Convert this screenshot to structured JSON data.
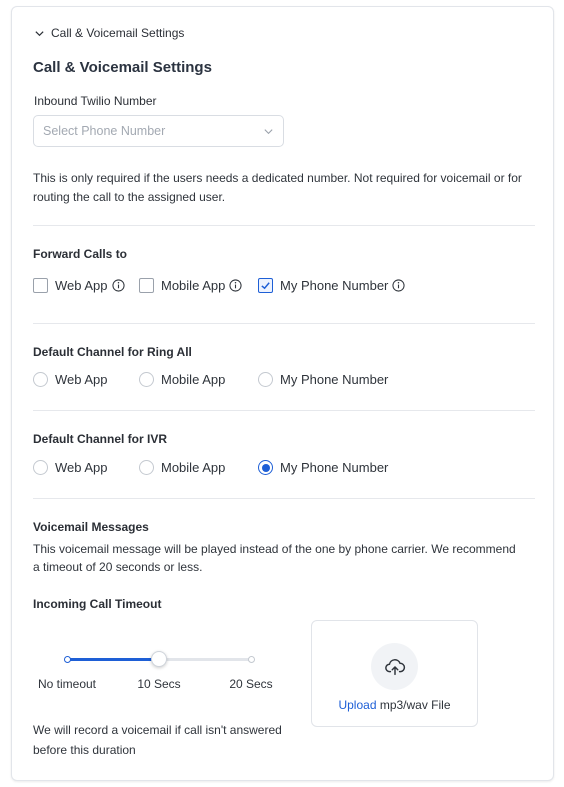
{
  "collapse": {
    "label": "Call & Voicemail Settings"
  },
  "title": "Call & Voicemail Settings",
  "inbound": {
    "label": "Inbound Twilio Number",
    "placeholder": "Select Phone Number",
    "help": "This is only required if the users needs a dedicated number. Not required for voicemail or for routing the call to the assigned user."
  },
  "forward": {
    "label": "Forward Calls to",
    "options": [
      {
        "label": "Web App",
        "checked": false
      },
      {
        "label": "Mobile App",
        "checked": false
      },
      {
        "label": "My Phone Number",
        "checked": true
      }
    ]
  },
  "ring_all": {
    "label": "Default Channel for Ring All",
    "options": [
      "Web App",
      "Mobile App",
      "My Phone Number"
    ],
    "selected": null
  },
  "ivr": {
    "label": "Default Channel for IVR",
    "options": [
      "Web App",
      "Mobile App",
      "My Phone Number"
    ],
    "selected": "My Phone Number"
  },
  "voicemail": {
    "label": "Voicemail Messages",
    "help": "This voicemail message will be played instead of the one by phone carrier. We recommend a timeout of 20 seconds or less."
  },
  "timeout": {
    "label": "Incoming Call Timeout",
    "stops": [
      "No timeout",
      "10 Secs",
      "20 Secs"
    ],
    "selected_index": 1,
    "help": "We will record a voicemail if call isn't answered before this duration"
  },
  "upload": {
    "link": "Upload",
    "text": " mp3/wav File"
  },
  "colors": {
    "accent": "#1e5fd6",
    "border": "#e2e5ea"
  },
  "icons": {
    "collapse": "chevron-down-icon",
    "select": "chevron-down-icon",
    "info": "info-icon",
    "upload": "cloud-upload-icon"
  }
}
